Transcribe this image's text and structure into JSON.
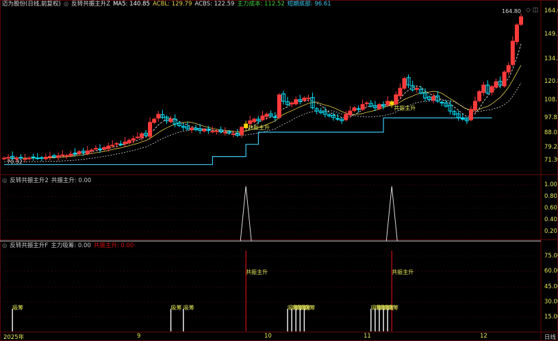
{
  "main": {
    "stock": "迈为股份(日线,前复权)",
    "indicator": "反转共振主升Z",
    "ma5": "MA5: 140.85",
    "acbl": "ACBL: 129.79",
    "acbs": "ACBS: 122.59",
    "cost": "主力成本: 112.52",
    "short": "短期底部: 96.61",
    "high_label": "164.80",
    "low_label": "70.32",
    "signal_label": "共振主升"
  },
  "panel2": {
    "indicator": "反转共振主升2",
    "value": "共振主升: 0.00",
    "yticks": [
      "1.00",
      "0.80",
      "0.60",
      "0.40",
      "0.20"
    ]
  },
  "panel3": {
    "indicator": "反转共振主升F",
    "absorb": "主力吸筹: 0.00",
    "signal": "共振主升: 0.00",
    "yticks": [
      "75.00",
      "60.00",
      "45.00",
      "30.00",
      "15.00"
    ],
    "absorb_label": "吸筹",
    "signal_label": "共振主升"
  },
  "yaxis": [
    "164.0",
    "149.1",
    "134.2",
    "120.8",
    "108.7",
    "97.81",
    "88.03",
    "79.23",
    "71.30"
  ],
  "xaxis": [
    "2025年",
    "9",
    "10",
    "11",
    "12"
  ],
  "period": "日线",
  "colors": {
    "up": "#ff3b3b",
    "down": "#00e5ff",
    "ma5": "#ffffff",
    "acbl": "#e8d44d",
    "support": "#3ec8f0",
    "signal": "#ffd700"
  },
  "chart_data": {
    "type": "candlestick",
    "closes": [
      73,
      73.5,
      72.8,
      73.2,
      73,
      72.6,
      73.1,
      73.4,
      73,
      73.2,
      73.6,
      74,
      73.8,
      74.5,
      75,
      74.6,
      75.5,
      76,
      77,
      76.4,
      77.5,
      78,
      79,
      78.2,
      79.5,
      80.5,
      81,
      82,
      81.5,
      83,
      84,
      85,
      86,
      88,
      87,
      95,
      97,
      100,
      98,
      96,
      97,
      94,
      93,
      92,
      91,
      91.5,
      90.5,
      90,
      90.6,
      90,
      89.5,
      89.8,
      89.2,
      89,
      88.5,
      88,
      87,
      92,
      94,
      96,
      97,
      96,
      99,
      100,
      99,
      98,
      112,
      108,
      106,
      107,
      109,
      108,
      110,
      110,
      104,
      102,
      101,
      100,
      99,
      98,
      97,
      96,
      100,
      102,
      104,
      103,
      106,
      107,
      105,
      104,
      106,
      105,
      108,
      106,
      112,
      116,
      122,
      118,
      115,
      116,
      113,
      110,
      109,
      111,
      108,
      107,
      105,
      102,
      100,
      98,
      97,
      96,
      103,
      108,
      114,
      118,
      113,
      117,
      120,
      118,
      126,
      130,
      145,
      155,
      160
    ],
    "signals_at": [
      58,
      93
    ],
    "absorb_at": [
      2,
      40,
      43,
      68,
      69,
      70,
      71,
      72,
      88,
      89,
      90,
      91,
      92
    ],
    "support": [
      [
        0,
        69
      ],
      [
        47,
        69
      ],
      [
        50,
        74
      ],
      [
        58,
        81.5
      ],
      [
        61,
        89
      ],
      [
        91,
        97.8
      ],
      [
        117,
        97.8
      ]
    ]
  }
}
